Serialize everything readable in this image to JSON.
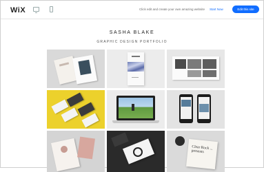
{
  "topbar": {
    "logo": "WiX",
    "promo_text": "Click edit and create your own amazing website",
    "start_now_label": "Start Now",
    "edit_button_label": "Edit this site"
  },
  "site": {
    "title": "SASHA BLAKE",
    "subtitle": "GRAPHIC DESIGN PORTFOLIO"
  },
  "colors": {
    "accent": "#116dff",
    "yellow_tile": "#ecd12c"
  },
  "icons": {
    "desktop": "desktop-icon",
    "mobile": "mobile-icon"
  },
  "portfolio": {
    "item_count": 9,
    "stationery_card_text": "Clear Rock ... presents"
  }
}
